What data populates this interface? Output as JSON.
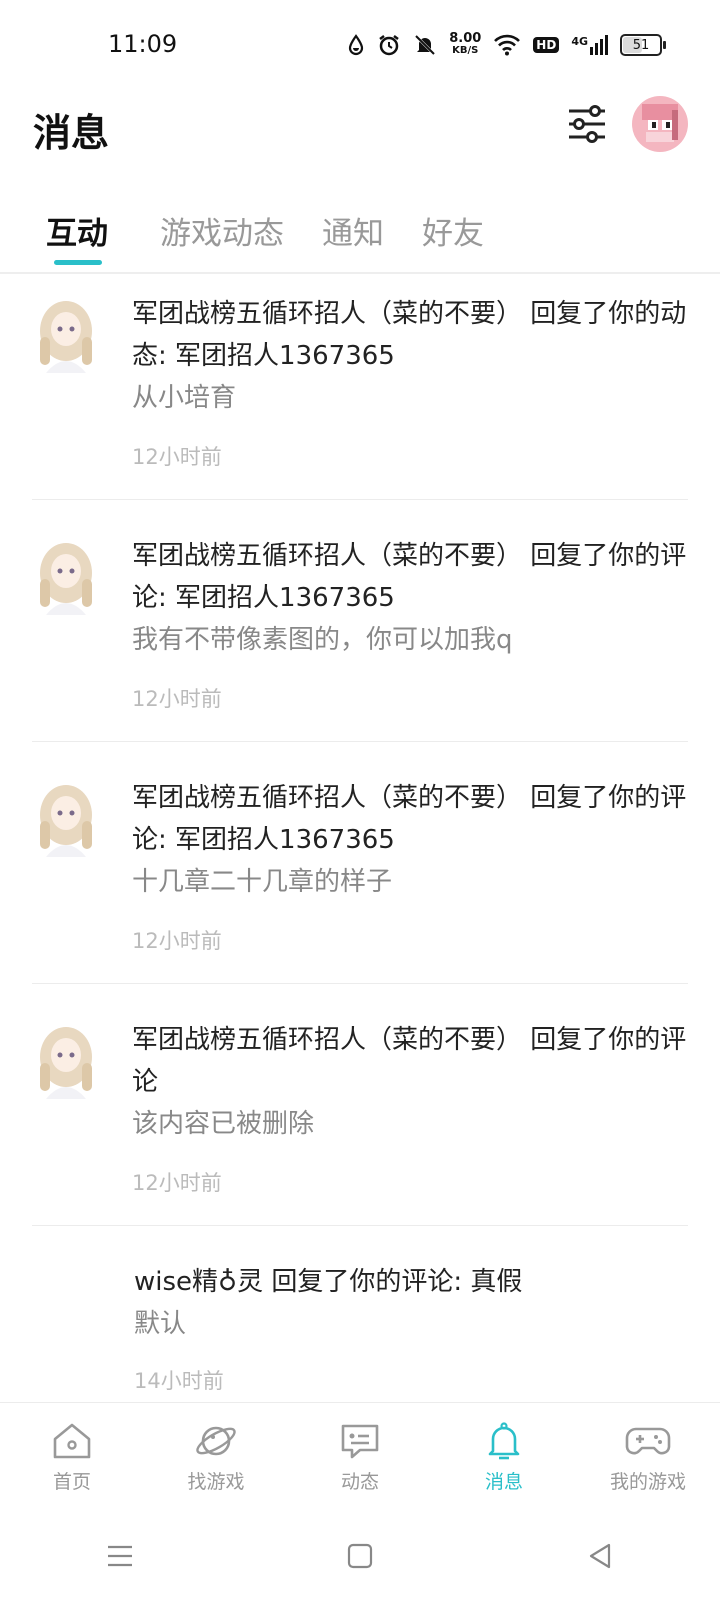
{
  "status_bar": {
    "time": "11:09",
    "net_speed_value": "8.00",
    "net_speed_unit": "KB/S",
    "hd": "HD",
    "signal": "4G",
    "battery": "51"
  },
  "header": {
    "title": "消息"
  },
  "tabs": [
    {
      "label": "互动",
      "active": true
    },
    {
      "label": "游戏动态",
      "active": false
    },
    {
      "label": "通知",
      "active": false
    },
    {
      "label": "好友",
      "active": false
    }
  ],
  "messages": [
    {
      "title": "军团战榜五循环招人（菜的不要） 回复了你的动态: 军团招人1367365",
      "body": "从小培育",
      "time": "12小时前"
    },
    {
      "title": "军团战榜五循环招人（菜的不要） 回复了你的评论: 军团招人1367365",
      "body": "我有不带像素图的，你可以加我q",
      "time": "12小时前"
    },
    {
      "title": "军团战榜五循环招人（菜的不要） 回复了你的评论: 军团招人1367365",
      "body": "十几章二十几章的样子",
      "time": "12小时前"
    },
    {
      "title": "军团战榜五循环招人（菜的不要） 回复了你的评论",
      "body": "该内容已被删除",
      "time": "12小时前"
    },
    {
      "title": "wise精♁灵 回复了你的评论: 真假",
      "body": "默认",
      "time": "14小时前"
    }
  ],
  "bottom_nav": [
    {
      "label": "首页",
      "icon": "home-icon"
    },
    {
      "label": "找游戏",
      "icon": "planet-icon"
    },
    {
      "label": "动态",
      "icon": "chat-icon"
    },
    {
      "label": "消息",
      "icon": "bell-icon"
    },
    {
      "label": "我的游戏",
      "icon": "gamepad-icon"
    }
  ],
  "colors": {
    "accent": "#2abfc9"
  }
}
